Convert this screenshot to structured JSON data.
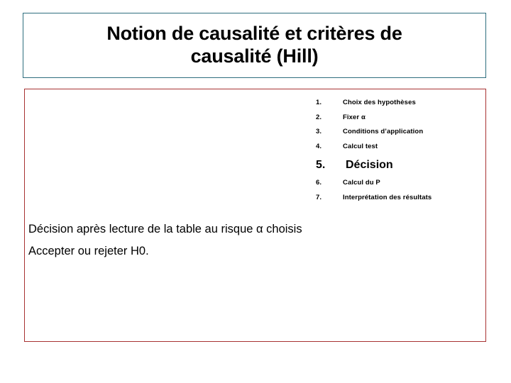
{
  "slide": {
    "title": "Notion de causalité et critères de\ncausalité (Hill)",
    "colors": {
      "title_border": "#2e6e7e",
      "content_border": "#a83232",
      "background": "#ffffff",
      "text": "#000000"
    },
    "steps": [
      {
        "number": "1.",
        "label": "Choix des hypothèses"
      },
      {
        "number": "2.",
        "label": "Fixer α"
      },
      {
        "number": "3.",
        "label": "Conditions d’application"
      },
      {
        "number": "4.",
        "label": "Calcul test"
      },
      {
        "number": "5.",
        "label": "Décision"
      },
      {
        "number": "6.",
        "label": "Calcul du P"
      },
      {
        "number": "7.",
        "label": "Interprétation des résultats"
      }
    ],
    "body_lines": [
      "Décision après lecture de la table au risque α choisis",
      "Accepter ou rejeter H0."
    ]
  }
}
